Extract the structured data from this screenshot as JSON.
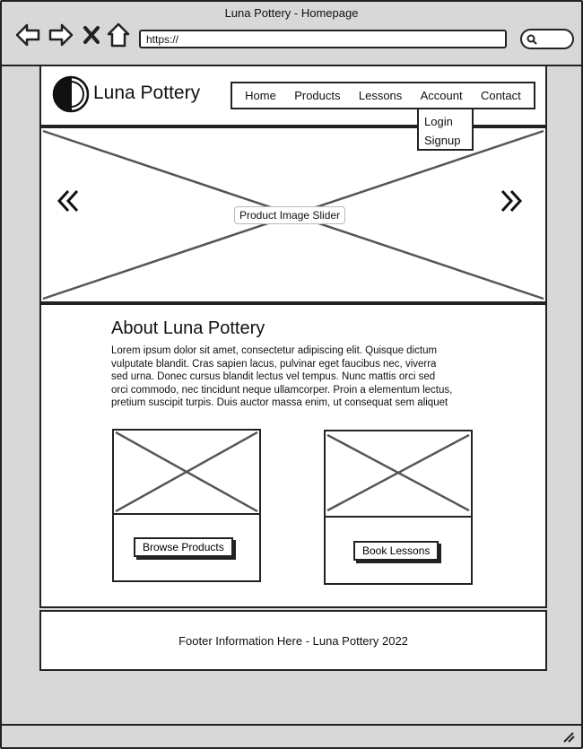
{
  "window": {
    "title": "Luna Pottery - Homepage"
  },
  "browser": {
    "url": "https://"
  },
  "header": {
    "brand": "Luna Pottery"
  },
  "nav": {
    "items": [
      {
        "label": "Home"
      },
      {
        "label": "Products"
      },
      {
        "label": "Lessons"
      },
      {
        "label": "Account"
      },
      {
        "label": "Contact"
      }
    ],
    "account_dropdown": [
      {
        "label": "Login"
      },
      {
        "label": "Signup"
      }
    ]
  },
  "slider": {
    "label": "Product Image Slider"
  },
  "about": {
    "title": "About Luna Pottery",
    "lines": [
      "Lorem ipsum dolor sit amet, consectetur adipiscing elit. Quisque dictum",
      "vulputate blandit. Cras sapien lacus, pulvinar eget faucibus nec, viverra",
      "sed urna. Donec cursus blandit lectus vel tempus. Nunc mattis orci sed",
      "orci commodo, nec tincidunt neque ullamcorper. Proin a elementum lectus,",
      "pretium suscipit turpis. Duis auctor massa enim, ut consequat sem aliquet"
    ]
  },
  "cards": [
    {
      "button": "Browse Products"
    },
    {
      "button": "Book Lessons"
    }
  ],
  "footer": {
    "text": "Footer Information Here - Luna Pottery 2022"
  },
  "colors": {
    "chrome": "#d8d8d8",
    "ink": "#222222",
    "placeholder_lines": "#555555"
  }
}
